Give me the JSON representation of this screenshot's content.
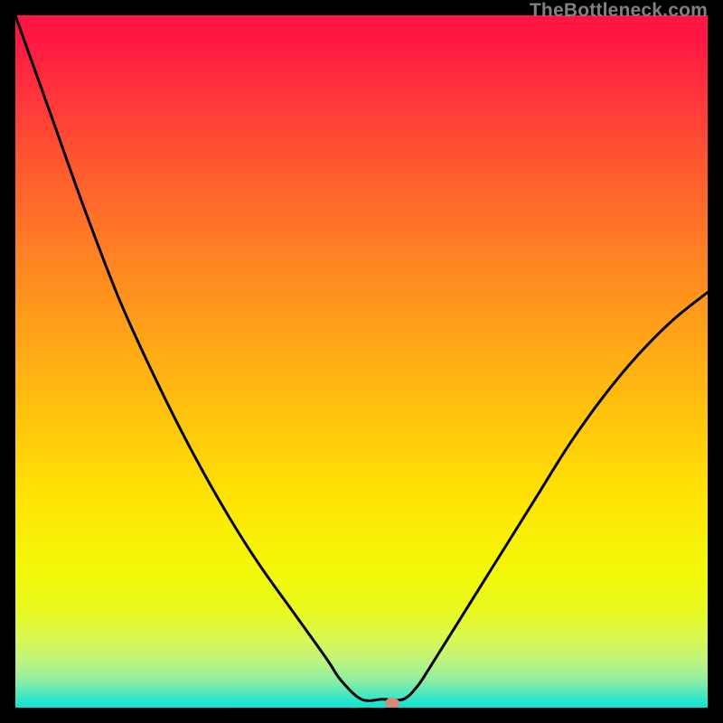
{
  "watermark": "TheBottleneck.com",
  "marker": {
    "x_frac": 0.544,
    "y_frac": 0.994,
    "color": "#d58a7a"
  },
  "chart_data": {
    "type": "line",
    "title": "",
    "xlabel": "",
    "ylabel": "",
    "xlim": [
      0,
      1
    ],
    "ylim": [
      0,
      1
    ],
    "grid": false,
    "legend": false,
    "annotations": [],
    "background": "vertical-gradient red→orange→yellow→green",
    "series": [
      {
        "name": "bottleneck-curve",
        "x": [
          0.0,
          0.05,
          0.1,
          0.15,
          0.2,
          0.25,
          0.3,
          0.35,
          0.4,
          0.45,
          0.47,
          0.5,
          0.53,
          0.56,
          0.58,
          0.6,
          0.65,
          0.7,
          0.75,
          0.8,
          0.85,
          0.9,
          0.95,
          1.0
        ],
        "y": [
          1.0,
          0.86,
          0.72,
          0.59,
          0.48,
          0.38,
          0.29,
          0.21,
          0.14,
          0.07,
          0.04,
          0.012,
          0.012,
          0.012,
          0.03,
          0.06,
          0.14,
          0.22,
          0.3,
          0.38,
          0.45,
          0.51,
          0.56,
          0.6
        ]
      }
    ],
    "marker_point": {
      "x": 0.544,
      "y": 0.006
    }
  }
}
